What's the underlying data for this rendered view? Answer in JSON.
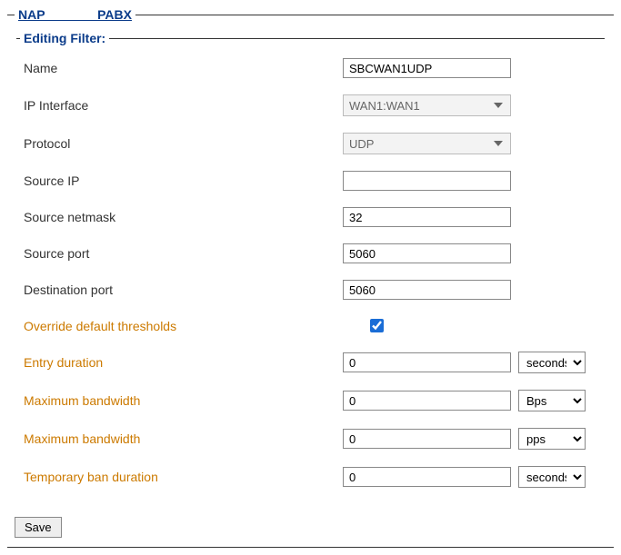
{
  "outer_legend": "NAP_   _PABX",
  "inner_legend": "Editing Filter:",
  "fields": {
    "name": {
      "label": "Name",
      "value": "SBCWAN1UDP"
    },
    "ip_interface": {
      "label": "IP Interface",
      "value": "WAN1:WAN1"
    },
    "protocol": {
      "label": "Protocol",
      "value": "UDP"
    },
    "source_ip": {
      "label": "Source IP",
      "value": ""
    },
    "source_netmask": {
      "label": "Source netmask",
      "value": "32"
    },
    "source_port": {
      "label": "Source port",
      "value": "5060"
    },
    "destination_port": {
      "label": "Destination port",
      "value": "5060"
    },
    "override": {
      "label": "Override default thresholds",
      "checked": true
    },
    "entry_duration": {
      "label": "Entry duration",
      "value": "0",
      "unit": "seconds"
    },
    "max_bandwidth_bps": {
      "label": "Maximum bandwidth",
      "value": "0",
      "unit": "Bps"
    },
    "max_bandwidth_pps": {
      "label": "Maximum bandwidth",
      "value": "0",
      "unit": "pps"
    },
    "temp_ban": {
      "label": "Temporary ban duration",
      "value": "0",
      "unit": "seconds"
    }
  },
  "buttons": {
    "save": "Save"
  }
}
